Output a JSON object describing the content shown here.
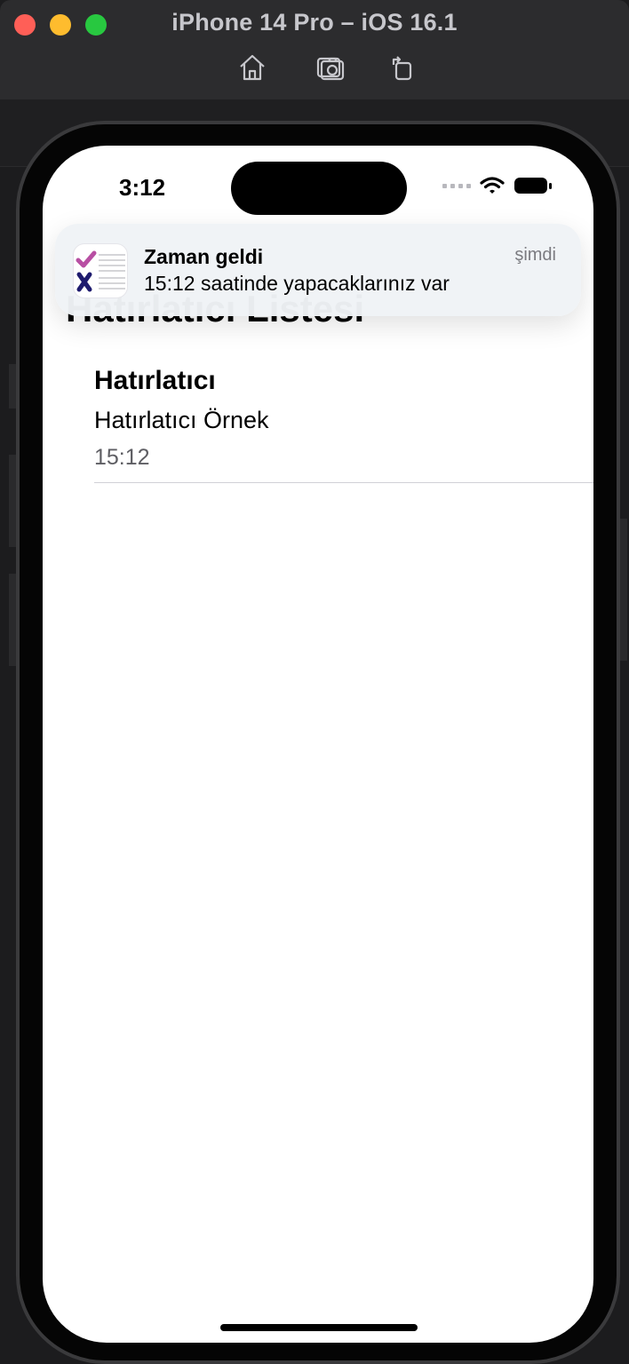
{
  "window": {
    "title": "iPhone 14 Pro – iOS 16.1",
    "toolbar": [
      "home-icon",
      "screenshot-icon",
      "rotate-icon"
    ]
  },
  "status_bar": {
    "time": "3:12"
  },
  "notification": {
    "title": "Zaman geldi",
    "body": "15:12 saatinde yapacaklarınız var",
    "time": "şimdi",
    "app_icon": "todo-checklist-icon",
    "accent_colors": [
      "#b84fa3",
      "#1e1b6e"
    ]
  },
  "screen": {
    "large_title": "Hatırlatıcı Listesi",
    "reminders": [
      {
        "title": "Hatırlatıcı",
        "subtitle": "Hatırlatıcı Örnek",
        "time": "15:12"
      }
    ]
  }
}
